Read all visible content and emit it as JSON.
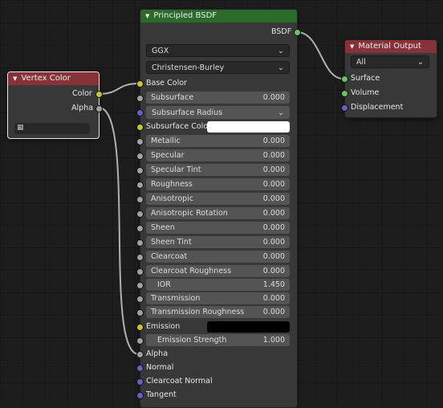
{
  "principled": {
    "title": "Principled BSDF",
    "output_label": "BSDF",
    "distribution": "GGX",
    "subsurface_method": "Christensen-Burley",
    "base_color_label": "Base Color",
    "subsurface_radius_label": "Subsurface Radius",
    "subsurface_color_label": "Subsurface Color",
    "emission_label": "Emission",
    "alpha_label": "Alpha",
    "normal_label": "Normal",
    "clearcoat_normal_label": "Clearcoat Normal",
    "tangent_label": "Tangent",
    "fields": [
      {
        "label": "Subsurface",
        "value": "0.000"
      },
      {
        "label": "Metallic",
        "value": "0.000"
      },
      {
        "label": "Specular",
        "value": "0.000"
      },
      {
        "label": "Specular Tint",
        "value": "0.000"
      },
      {
        "label": "Roughness",
        "value": "0.000"
      },
      {
        "label": "Anisotropic",
        "value": "0.000"
      },
      {
        "label": "Anisotropic Rotation",
        "value": "0.000"
      },
      {
        "label": "Sheen",
        "value": "0.000"
      },
      {
        "label": "Sheen Tint",
        "value": "0.000"
      },
      {
        "label": "Clearcoat",
        "value": "0.000"
      },
      {
        "label": "Clearcoat Roughness",
        "value": "0.000"
      },
      {
        "label": "IOR",
        "value": "1.450"
      },
      {
        "label": "Transmission",
        "value": "0.000"
      },
      {
        "label": "Transmission Roughness",
        "value": "0.000"
      },
      {
        "label": "Emission Strength",
        "value": "1.000"
      }
    ]
  },
  "vertex_color": {
    "title": "Vertex Color",
    "color_label": "Color",
    "alpha_label": "Alpha"
  },
  "material_output": {
    "title": "Material Output",
    "target": "All",
    "surface_label": "Surface",
    "volume_label": "Volume",
    "displacement_label": "Displacement"
  },
  "colors": {
    "subsurface_color": "#ffffff",
    "emission_color": "#000000",
    "header_shader": "#2a6b2a",
    "header_input": "#863237",
    "header_output": "#863237"
  }
}
